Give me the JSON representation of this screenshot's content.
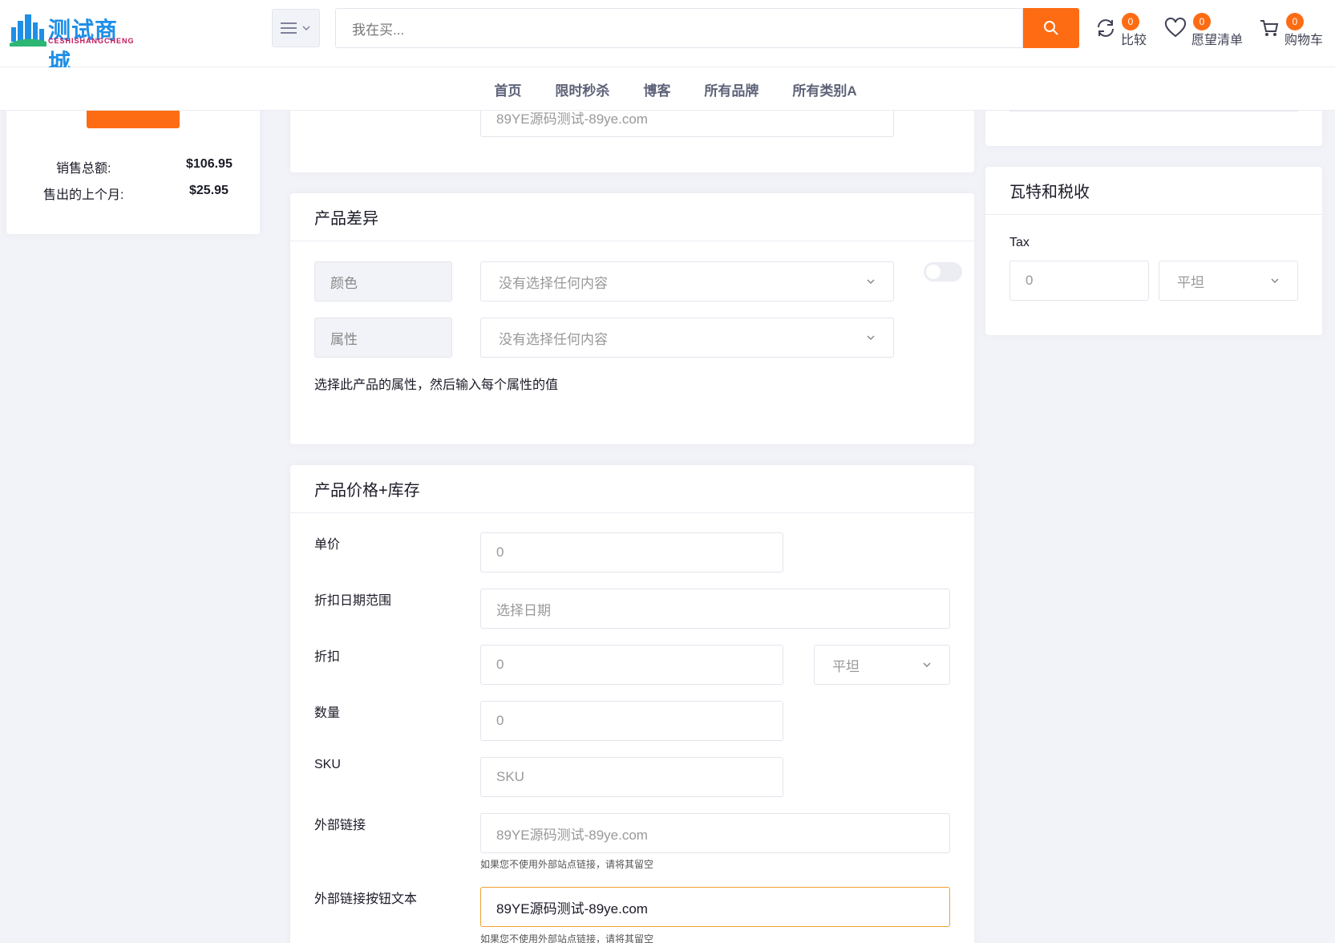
{
  "header": {
    "logo_text": "测试商城",
    "logo_sub": "CESHISHANGCHENG",
    "search_placeholder": "我在买...",
    "compare": {
      "label": "比较",
      "count": "0"
    },
    "wishlist": {
      "label": "愿望清单",
      "count": "0"
    },
    "cart": {
      "label": "购物车",
      "count": "0"
    }
  },
  "nav": [
    "首页",
    "限时秒杀",
    "博客",
    "所有品牌",
    "所有类别A"
  ],
  "sidebar": {
    "total_sales_label": "销售总额:",
    "total_sales_value": "$106.95",
    "last_month_label": "售出的上个月:",
    "last_month_value": "$25.95"
  },
  "top_card": {
    "input_value": "89YE源码测试-89ye.com"
  },
  "variation": {
    "title": "产品差异",
    "color_label": "颜色",
    "color_placeholder": "没有选择任何内容",
    "attr_label": "属性",
    "attr_placeholder": "没有选择任何内容",
    "help": "选择此产品的属性，然后输入每个属性的值"
  },
  "price_stock": {
    "title": "产品价格+库存",
    "unit_price_label": "单价",
    "unit_price_value": "0",
    "discount_range_label": "折扣日期范围",
    "discount_range_placeholder": "选择日期",
    "discount_label": "折扣",
    "discount_value": "0",
    "discount_type": "平坦",
    "quantity_label": "数量",
    "quantity_value": "0",
    "sku_label": "SKU",
    "sku_placeholder": "SKU",
    "external_link_label": "外部链接",
    "external_link_value": "89YE源码测试-89ye.com",
    "external_link_hint": "如果您不使用外部站点链接，请将其留空",
    "external_btn_label": "外部链接按钮文本",
    "external_btn_value": "89YE源码测试-89ye.com",
    "external_btn_hint": "如果您不使用外部站点链接，请将其留空"
  },
  "vat": {
    "title": "瓦特和税收",
    "tax_label": "Tax",
    "tax_value": "0",
    "tax_type": "平坦"
  },
  "colors": {
    "accent": "#fd6c13",
    "brand": "#1f8fe6"
  }
}
